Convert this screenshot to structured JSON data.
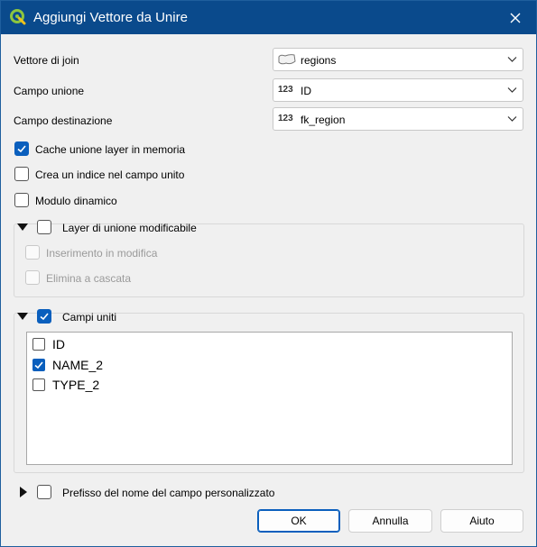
{
  "window": {
    "title": "Aggiungi Vettore da Unire",
    "logo_icon": "qgis-logo-icon",
    "close_icon": "close-icon"
  },
  "fields": {
    "join_layer": {
      "label": "Vettore di join",
      "value": "regions",
      "icon": "polygon-layer-icon"
    },
    "join_field": {
      "label": "Campo unione",
      "value": "ID",
      "type_badge": "123"
    },
    "target_field": {
      "label": "Campo destinazione",
      "value": "fk_region",
      "type_badge": "123"
    }
  },
  "options": {
    "cache": {
      "label": "Cache unione layer in memoria",
      "checked": true
    },
    "index": {
      "label": "Crea un indice nel campo unito",
      "checked": false
    },
    "dynamic_form": {
      "label": "Modulo dinamico",
      "checked": false
    }
  },
  "editable_group": {
    "label": "Layer di unione modificabile",
    "checked": false,
    "expanded": true,
    "upsert": {
      "label": "Inserimento in modifica",
      "checked": false,
      "enabled": false
    },
    "cascade": {
      "label": "Elimina a cascata",
      "checked": false,
      "enabled": false
    }
  },
  "joined_fields_group": {
    "label": "Campi uniti",
    "checked": true,
    "expanded": true,
    "items": [
      {
        "label": "ID",
        "checked": false
      },
      {
        "label": "NAME_2",
        "checked": true
      },
      {
        "label": "TYPE_2",
        "checked": false
      }
    ]
  },
  "prefix_group": {
    "label": "Prefisso del nome del campo personalizzato",
    "checked": false,
    "expanded": false
  },
  "buttons": {
    "ok": "OK",
    "cancel": "Annulla",
    "help": "Aiuto"
  },
  "colors": {
    "titlebar": "#0a4a8c",
    "accent": "#0a5fbd",
    "background": "#f0f0f0"
  }
}
